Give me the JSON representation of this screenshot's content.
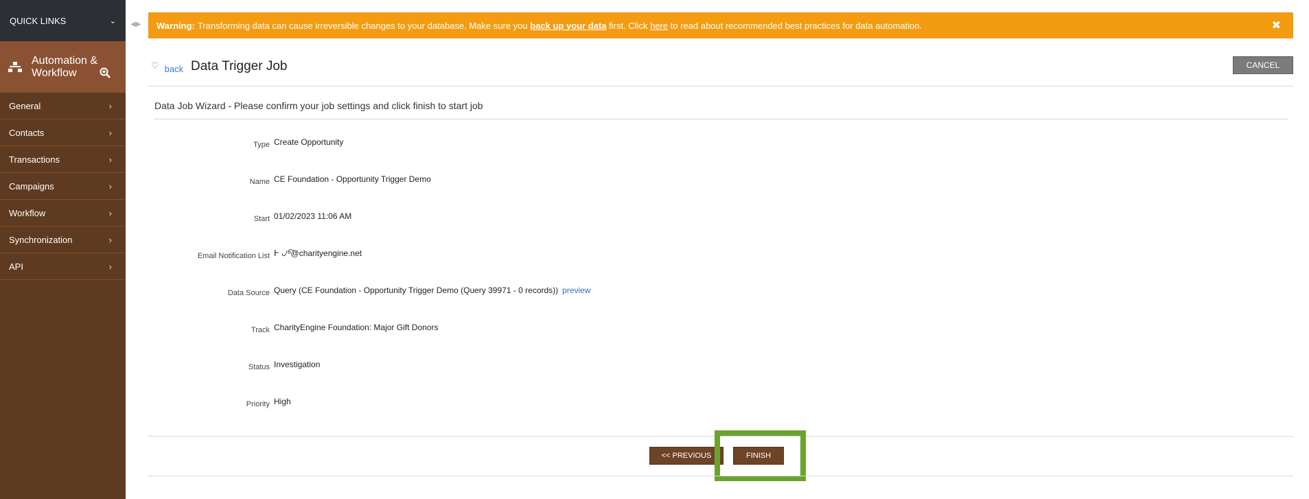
{
  "sidebar": {
    "quick_links": "QUICK LINKS",
    "module_title": "Automation & Workflow",
    "items": [
      {
        "label": "General"
      },
      {
        "label": "Contacts"
      },
      {
        "label": "Transactions"
      },
      {
        "label": "Campaigns"
      },
      {
        "label": "Workflow"
      },
      {
        "label": "Synchronization"
      },
      {
        "label": "API"
      }
    ],
    "colors": {
      "sidebar_bg": "#5e3a20",
      "module_bg": "#8a5233",
      "quick_links_bg": "#2c3035"
    }
  },
  "warning": {
    "strong": "Warning:",
    "text1": "Transforming data can cause irreversible changes to your database. Make sure you",
    "link1": "back up your data",
    "text2": "first. Click",
    "link2": "here",
    "text3": "to read about recommended best practices for data automation.",
    "close": "✖",
    "color": "#f39c12"
  },
  "header": {
    "back": "back",
    "title": "Data Trigger Job",
    "cancel": "CANCEL"
  },
  "wizard": {
    "heading": "Data Job Wizard - Please confirm your job settings and click finish to start job",
    "fields": [
      {
        "label": "Type",
        "value": "Create Opportunity"
      },
      {
        "label": "Name",
        "value": "CE Foundation - Opportunity Trigger Demo"
      },
      {
        "label": "Start",
        "value": "01/02/2023 11:06 AM"
      },
      {
        "label": "Email Notification List",
        "value": "Ͱ ᴗ ͫ͡ @charityengine.net"
      },
      {
        "label": "Data Source",
        "value": "Query (CE Foundation - Opportunity Trigger Demo (Query 39971 - 0 records))",
        "link": "preview"
      },
      {
        "label": "Track",
        "value": "CharityEngine Foundation: Major Gift Donors"
      },
      {
        "label": "Status",
        "value": "Investigation"
      },
      {
        "label": "Priority",
        "value": "High"
      }
    ]
  },
  "footer": {
    "previous": "<< PREVIOUS",
    "finish": "FINISH",
    "highlight_color": "#6aa32f",
    "button_color": "#6e4326"
  }
}
